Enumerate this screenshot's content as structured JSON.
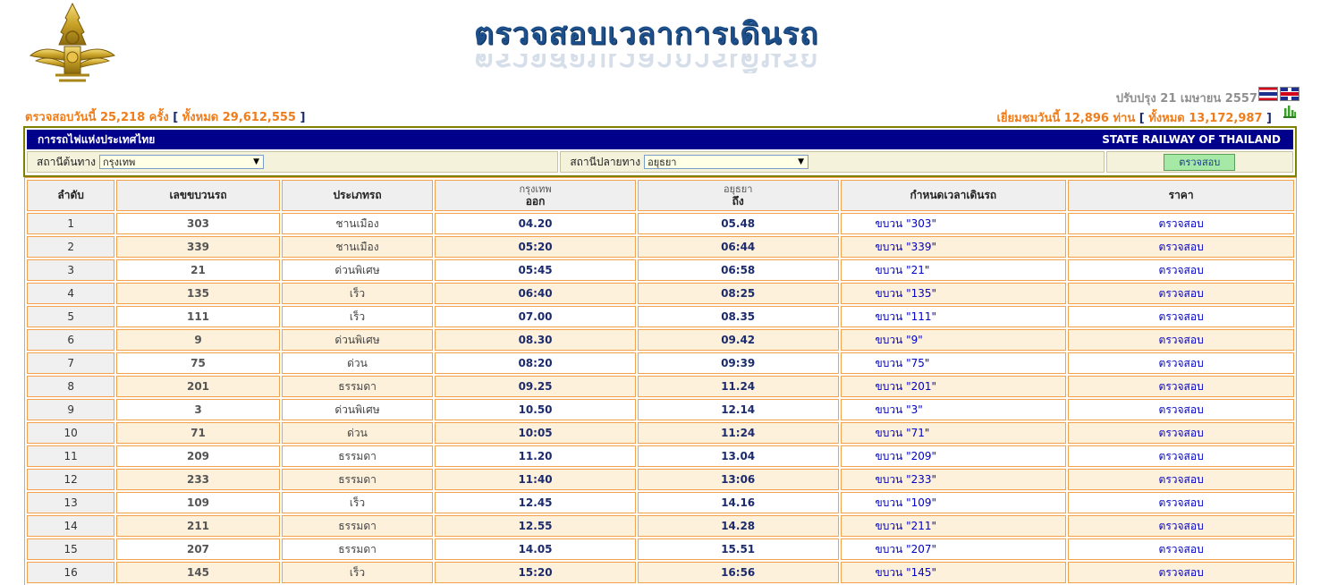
{
  "header": {
    "title": "ตรวจสอบเวลาการเดินรถ",
    "updated": "ปรับปรุง 21 เมษายน 2557"
  },
  "stats": {
    "checks_today_label": "ตรวจสอบวันนี้",
    "checks_today_value": "25,218",
    "checks_unit": "ครั้ง",
    "checks_total_label": "ทั้งหมด",
    "checks_total_value": "29,612,555",
    "visits_today_label": "เยี่ยมชมวันนี้",
    "visits_today_value": "12,896",
    "visits_unit": "ท่าน",
    "visits_total_label": "ทั้งหมด",
    "visits_total_value": "13,172,987",
    "open_bracket": "[",
    "close_bracket": "]"
  },
  "search": {
    "org_name_th": "การรถไฟแห่งประเทศไทย",
    "org_name_en": "STATE RAILWAY OF THAILAND",
    "origin_label": "สถานีต้นทาง",
    "origin_value": "กรุงเทพ",
    "dest_label": "สถานีปลายทาง",
    "dest_value": "อยุธยา",
    "submit_label": "ตรวจสอบ"
  },
  "table": {
    "headers": {
      "seq": "ลำดับ",
      "train_no": "เลขขบวนรถ",
      "type": "ประเภทรถ",
      "origin_station": "กรุงเทพ",
      "depart": "ออก",
      "dest_station": "อยุธยา",
      "arrive": "ถึง",
      "schedule": "กำหนดเวลาเดินรถ",
      "price": "ราคา"
    },
    "rows": [
      {
        "seq": "1",
        "train": "303",
        "type": "ชานเมือง",
        "dep": "04.20",
        "arr": "05.48",
        "sched": "ขบวน \"303\"",
        "price": "ตรวจสอบ"
      },
      {
        "seq": "2",
        "train": "339",
        "type": "ชานเมือง",
        "dep": "05:20",
        "arr": "06:44",
        "sched": "ขบวน \"339\"",
        "price": "ตรวจสอบ"
      },
      {
        "seq": "3",
        "train": "21",
        "type": "ด่วนพิเศษ",
        "dep": "05:45",
        "arr": "06:58",
        "sched": "ขบวน \"21\"",
        "price": "ตรวจสอบ"
      },
      {
        "seq": "4",
        "train": "135",
        "type": "เร็ว",
        "dep": "06:40",
        "arr": "08:25",
        "sched": "ขบวน \"135\"",
        "price": "ตรวจสอบ"
      },
      {
        "seq": "5",
        "train": "111",
        "type": "เร็ว",
        "dep": "07.00",
        "arr": "08.35",
        "sched": "ขบวน \"111\"",
        "price": "ตรวจสอบ"
      },
      {
        "seq": "6",
        "train": "9",
        "type": "ด่วนพิเศษ",
        "dep": "08.30",
        "arr": "09.42",
        "sched": "ขบวน \"9\"",
        "price": "ตรวจสอบ"
      },
      {
        "seq": "7",
        "train": "75",
        "type": "ด่วน",
        "dep": "08:20",
        "arr": "09:39",
        "sched": "ขบวน \"75\"",
        "price": "ตรวจสอบ"
      },
      {
        "seq": "8",
        "train": "201",
        "type": "ธรรมดา",
        "dep": "09.25",
        "arr": "11.24",
        "sched": "ขบวน \"201\"",
        "price": "ตรวจสอบ"
      },
      {
        "seq": "9",
        "train": "3",
        "type": "ด่วนพิเศษ",
        "dep": "10.50",
        "arr": "12.14",
        "sched": "ขบวน \"3\"",
        "price": "ตรวจสอบ"
      },
      {
        "seq": "10",
        "train": "71",
        "type": "ด่วน",
        "dep": "10:05",
        "arr": "11:24",
        "sched": "ขบวน \"71\"",
        "price": "ตรวจสอบ"
      },
      {
        "seq": "11",
        "train": "209",
        "type": "ธรรมดา",
        "dep": "11.20",
        "arr": "13.04",
        "sched": "ขบวน \"209\"",
        "price": "ตรวจสอบ"
      },
      {
        "seq": "12",
        "train": "233",
        "type": "ธรรมดา",
        "dep": "11:40",
        "arr": "13:06",
        "sched": "ขบวน \"233\"",
        "price": "ตรวจสอบ"
      },
      {
        "seq": "13",
        "train": "109",
        "type": "เร็ว",
        "dep": "12.45",
        "arr": "14.16",
        "sched": "ขบวน \"109\"",
        "price": "ตรวจสอบ"
      },
      {
        "seq": "14",
        "train": "211",
        "type": "ธรรมดา",
        "dep": "12.55",
        "arr": "14.28",
        "sched": "ขบวน \"211\"",
        "price": "ตรวจสอบ"
      },
      {
        "seq": "15",
        "train": "207",
        "type": "ธรรมดา",
        "dep": "14.05",
        "arr": "15.51",
        "sched": "ขบวน \"207\"",
        "price": "ตรวจสอบ"
      },
      {
        "seq": "16",
        "train": "145",
        "type": "เร็ว",
        "dep": "15:20",
        "arr": "16:56",
        "sched": "ขบวน \"145\"",
        "price": "ตรวจสอบ"
      }
    ]
  },
  "icons": {
    "logo": "srt-winged-emblem-icon",
    "flag_th": "thai-flag-icon",
    "flag_en": "uk-flag-icon",
    "stats": "bar-chart-icon",
    "dropdown": "dropdown-arrow-icon"
  },
  "colors": {
    "accent_orange": "#f07d1b",
    "header_navy": "#00008b",
    "table_border": "#f3a14a",
    "row_alt": "#fdf1dc",
    "link_blue": "#0000c8",
    "gold": "#c9a227"
  }
}
